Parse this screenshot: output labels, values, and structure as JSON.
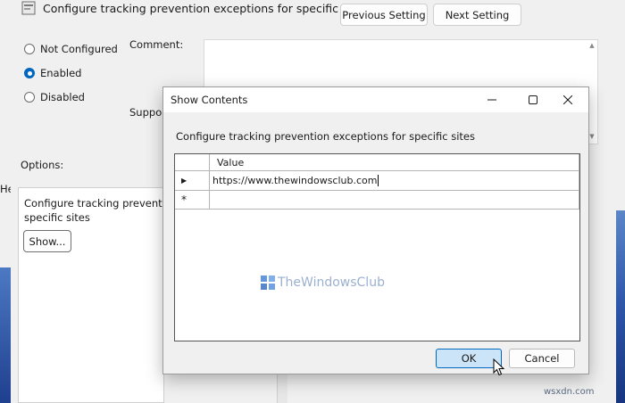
{
  "policy": {
    "title": "Configure tracking prevention exceptions for specific sites",
    "prev_button": "Previous Setting",
    "next_button": "Next Setting",
    "radios": [
      {
        "label": "Not Configured",
        "selected": false
      },
      {
        "label": "Enabled",
        "selected": true
      },
      {
        "label": "Disabled",
        "selected": false
      }
    ],
    "comment_label": "Comment:",
    "supported_label": "Supported on:",
    "options_label": "Options:",
    "help_label": "Help:",
    "options_text_line1": "Configure tracking prevention",
    "options_text_line2": "specific sites",
    "show_button": "Show..."
  },
  "dialog": {
    "title": "Show Contents",
    "caption": "Configure tracking prevention exceptions for specific sites",
    "column_header": "Value",
    "rows": [
      {
        "marker": "▶",
        "value": "https://www.thewindowsclub.com"
      },
      {
        "marker": "*",
        "value": ""
      }
    ],
    "ok_button": "OK",
    "cancel_button": "Cancel"
  },
  "watermark": {
    "brand": "TheWindowsClub",
    "site": "wsxdn.com"
  },
  "colors": {
    "accent": "#0067c0",
    "ok_fill": "#cce4f7",
    "wallpaper": "#2d55a8"
  }
}
